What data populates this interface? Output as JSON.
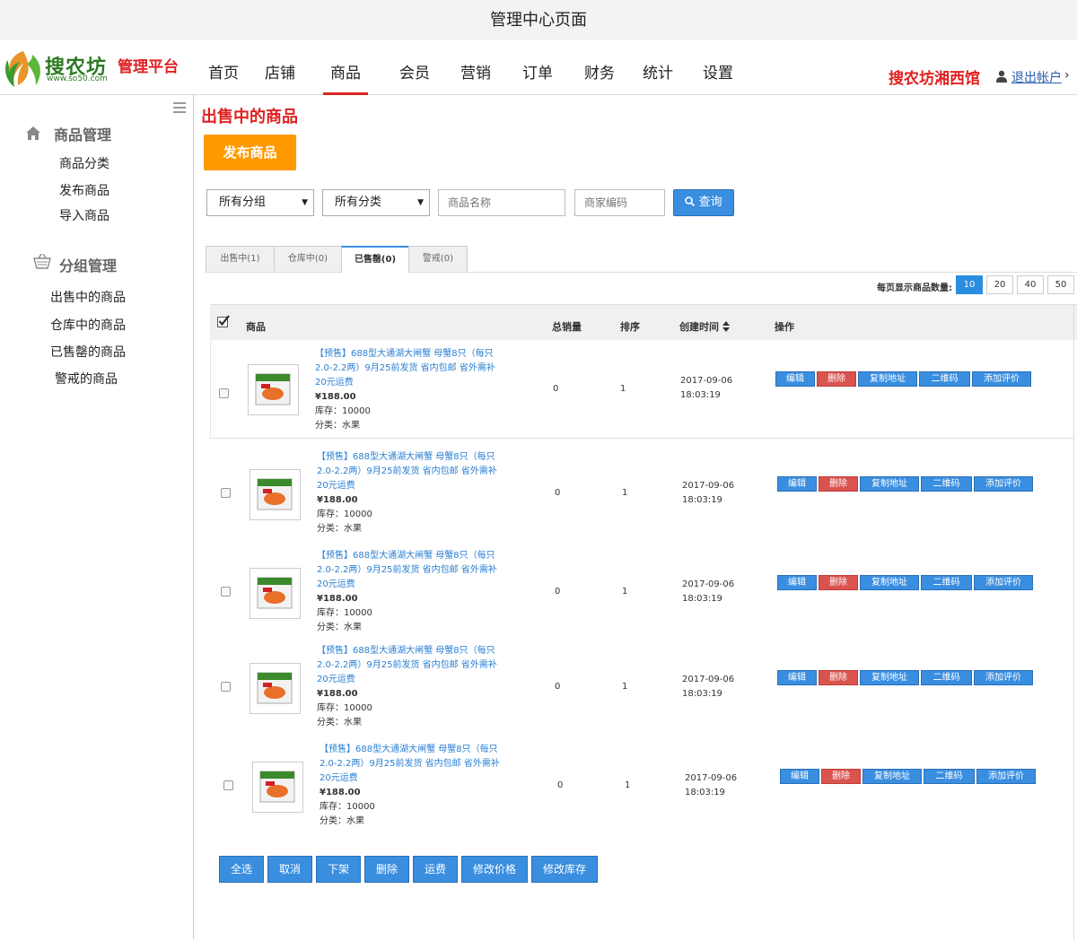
{
  "window_title": "管理中心页面",
  "header": {
    "logo_text": "搜农坊",
    "logo_sub": "www.so50.com",
    "platform": "管理平台",
    "nav": [
      "首页",
      "店铺",
      "商品",
      "会员",
      "营销",
      "订单",
      "财务",
      "统计",
      "设置"
    ],
    "nav_active": "商品",
    "shop_name": "搜农坊湘西馆",
    "logout": "退出帐户",
    "logout_caret": "›"
  },
  "sidebar": {
    "group1_title": "商品管理",
    "group1_items": [
      "商品分类",
      "发布商品",
      "导入商品"
    ],
    "group2_title": "分组管理",
    "group2_items": [
      "出售中的商品",
      "仓库中的商品",
      "已售罄的商品",
      "警戒的商品"
    ]
  },
  "main": {
    "title": "出售中的商品",
    "publish_btn": "发布商品",
    "filter": {
      "group_select": "所有分组",
      "category_select": "所有分类",
      "name_placeholder": "商品名称",
      "code_placeholder": "商家编码",
      "search_btn": "查询"
    },
    "tabs": [
      "出售中(1)",
      "仓库中(0)",
      "已售罄(0)",
      "警戒(0)"
    ],
    "active_tab": "已售罄(0)",
    "per_page_label": "每页显示商品数量:",
    "per_page_options": [
      "10",
      "20",
      "40",
      "50"
    ],
    "per_page_selected": "10",
    "columns": [
      "商品",
      "总销量",
      "排序",
      "创建时间",
      "操作"
    ],
    "rows": [
      {
        "name": "【预售】688型大通湖大闸蟹 母蟹8只（每只2.0-2.2两）9月25前发货 省内包邮 省外需补20元运费",
        "price": "¥188.00",
        "stock": "库存：10000",
        "category": "分类：水果",
        "sales": "0",
        "sort": "1",
        "date": "2017-09-06",
        "time": "18:03:19"
      },
      {
        "name": "【预售】688型大通湖大闸蟹 母蟹8只（每只2.0-2.2两）9月25前发货 省内包邮 省外需补20元运费",
        "price": "¥188.00",
        "stock": "库存：10000",
        "category": "分类：水果",
        "sales": "0",
        "sort": "1",
        "date": "2017-09-06",
        "time": "18:03:19"
      },
      {
        "name": "【预售】688型大通湖大闸蟹 母蟹8只（每只2.0-2.2两）9月25前发货 省内包邮 省外需补20元运费",
        "price": "¥188.00",
        "stock": "库存：10000",
        "category": "分类：水果",
        "sales": "0",
        "sort": "1",
        "date": "2017-09-06",
        "time": "18:03:19"
      },
      {
        "name": "【预售】688型大通湖大闸蟹 母蟹8只（每只2.0-2.2两）9月25前发货 省内包邮 省外需补20元运费",
        "price": "¥188.00",
        "stock": "库存：10000",
        "category": "分类：水果",
        "sales": "0",
        "sort": "1",
        "date": "2017-09-06",
        "time": "18:03:19"
      },
      {
        "name": "【预售】688型大通湖大闸蟹 母蟹8只（每只2.0-2.2两）9月25前发货 省内包邮 省外需补20元运费",
        "price": "¥188.00",
        "stock": "库存：10000",
        "category": "分类：水果",
        "sales": "0",
        "sort": "1",
        "date": "2017-09-06",
        "time": "18:03:19"
      }
    ],
    "row_ops": [
      "编辑",
      "删除",
      "复制地址",
      "二维码",
      "添加评价"
    ],
    "bottom_buttons": [
      "全选",
      "取消",
      "下架",
      "删除",
      "运费",
      "修改价格",
      "修改库存"
    ]
  },
  "colors": {
    "brand_red": "#e02020",
    "primary_blue": "#3a8ee0",
    "danger_red": "#d9534f",
    "publish_orange": "#ff9900",
    "logo_green": "#2d7a23"
  },
  "icons": {
    "logo": "leaf-logo-icon",
    "user": "user-icon",
    "menu": "hamburger-icon",
    "home": "home-icon",
    "basket": "basket-icon",
    "search": "search-icon",
    "sort": "sort-icon",
    "check": "checkbox-checked-icon"
  }
}
